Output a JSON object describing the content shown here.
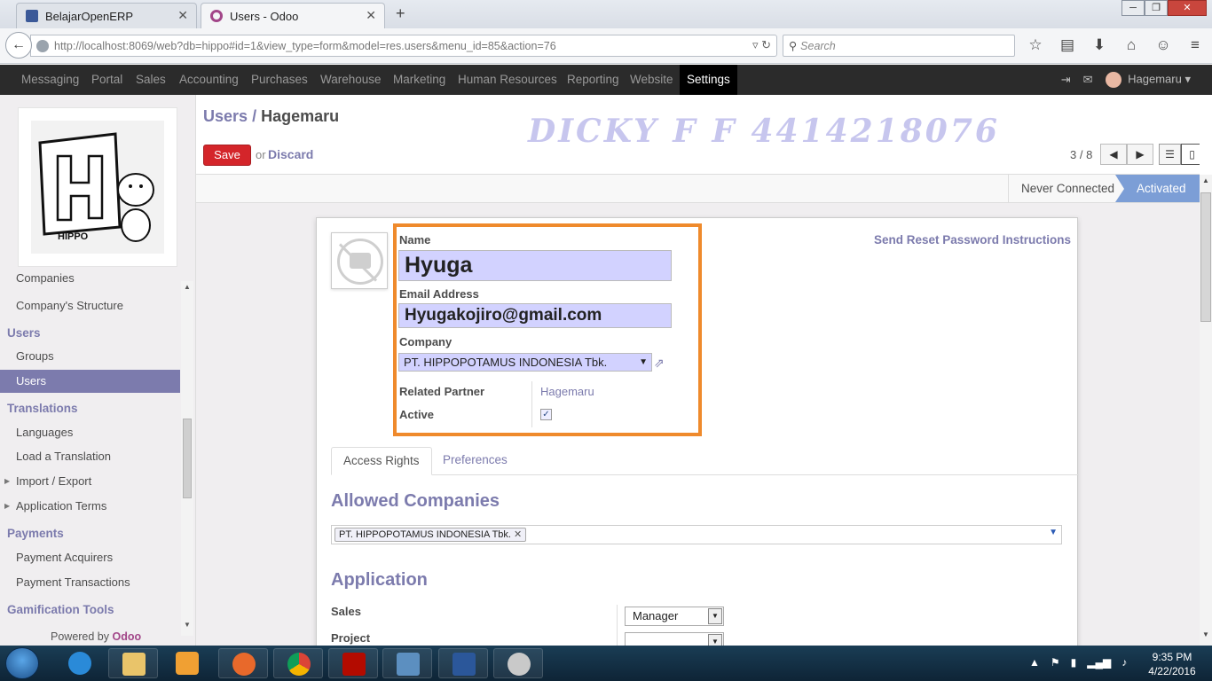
{
  "browser": {
    "tabs": [
      {
        "label": "BelajarOpenERP",
        "active": false
      },
      {
        "label": "Users - Odoo",
        "active": true
      }
    ],
    "url": "http://localhost:8069/web?db=hippo#id=1&view_type=form&model=res.users&menu_id=85&action=76",
    "search_placeholder": "Search"
  },
  "top_menu": {
    "items": [
      "Messaging",
      "Portal",
      "Sales",
      "Accounting",
      "Purchases",
      "Warehouse",
      "Marketing",
      "Human Resources",
      "Reporting",
      "Website",
      "Settings"
    ],
    "active": "Settings",
    "user": "Hagemaru"
  },
  "sidebar": {
    "logo_text": "HIPPO",
    "items": [
      {
        "label": "Companies",
        "type": "item"
      },
      {
        "label": "Company's Structure",
        "type": "item"
      },
      {
        "label": "Users",
        "type": "header"
      },
      {
        "label": "Groups",
        "type": "item"
      },
      {
        "label": "Users",
        "type": "item",
        "active": true
      },
      {
        "label": "Translations",
        "type": "header"
      },
      {
        "label": "Languages",
        "type": "item"
      },
      {
        "label": "Load a Translation",
        "type": "item"
      },
      {
        "label": "Import / Export",
        "type": "item",
        "expandable": true
      },
      {
        "label": "Application Terms",
        "type": "item",
        "expandable": true
      },
      {
        "label": "Payments",
        "type": "header"
      },
      {
        "label": "Payment Acquirers",
        "type": "item"
      },
      {
        "label": "Payment Transactions",
        "type": "item"
      },
      {
        "label": "Gamification Tools",
        "type": "header"
      }
    ],
    "powered_by": "Powered by",
    "powered_brand": "Odoo"
  },
  "control_panel": {
    "breadcrumb_parent": "Users",
    "breadcrumb_sep": "/",
    "breadcrumb_current": "Hagemaru",
    "watermark": "DICKY F F 4414218076",
    "save_label": "Save",
    "or_label": "or",
    "discard_label": "Discard",
    "pager": "3 / 8"
  },
  "status": {
    "stages": [
      "Never Connected",
      "Activated"
    ],
    "active": "Activated"
  },
  "form": {
    "reset_link": "Send Reset Password Instructions",
    "name_label": "Name",
    "name_value": "Hyuga",
    "email_label": "Email Address",
    "email_value": "Hyugakojiro@gmail.com",
    "company_label": "Company",
    "company_value": "PT. HIPPOPOTAMUS INDONESIA Tbk.",
    "partner_label": "Related Partner",
    "partner_value": "Hagemaru",
    "active_label": "Active",
    "active_checked": true,
    "tabs": [
      "Access Rights",
      "Preferences"
    ],
    "active_tab": "Access Rights",
    "allowed_companies_title": "Allowed Companies",
    "allowed_companies_tag": "PT. HIPPOPOTAMUS INDONESIA Tbk.",
    "application_title": "Application",
    "sales_label": "Sales",
    "sales_value": "Manager",
    "project_label": "Project",
    "project_value": ""
  },
  "taskbar": {
    "time": "9:35 PM",
    "date": "4/22/2016"
  },
  "colors": {
    "odoo_purple": "#7c7bad",
    "save_red": "#d4252a",
    "highlight_orange": "#ef8a2c",
    "field_fill": "#d2d2ff",
    "stage_active": "#7c9ed6"
  }
}
